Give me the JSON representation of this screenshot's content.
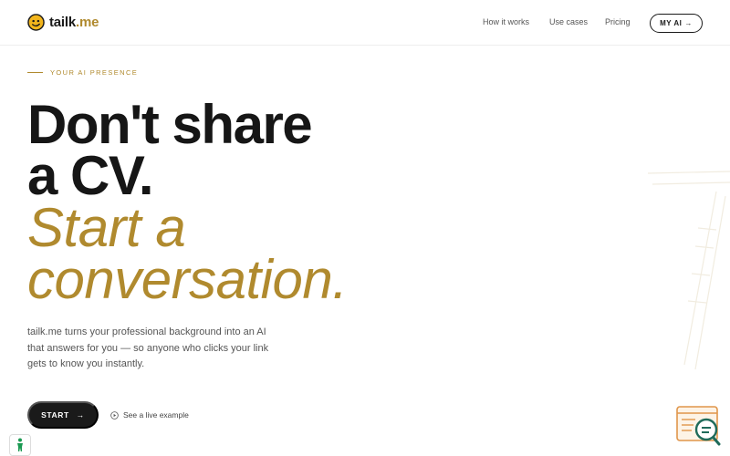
{
  "header": {
    "logo_name": "tailk",
    "logo_dot": ".me",
    "nav": [
      {
        "label": "How it works"
      },
      {
        "label": "Use cases"
      },
      {
        "label": "Pricing"
      }
    ],
    "myai_label": "MY AI",
    "myai_arrow": "→"
  },
  "hero": {
    "eyebrow": "YOUR AI PRESENCE",
    "headline_line1": "Don't share",
    "headline_line2": "a CV.",
    "headline_line3": "Start a",
    "headline_line4": "conversation.",
    "description": "tailk.me turns your professional background into an AI that answers for you — so anyone who clicks your link gets to know you instantly.",
    "start_label": "START",
    "start_arrow": "→",
    "live_example_label": "See a live example"
  },
  "colors": {
    "accent": "#b08a2e",
    "dark": "#1a1a1a",
    "deco_orange": "#e0954a"
  },
  "icons": [
    "logo-icon",
    "arrow-right-icon",
    "play-circle-icon",
    "chat-search-icon",
    "accessibility-icon"
  ]
}
